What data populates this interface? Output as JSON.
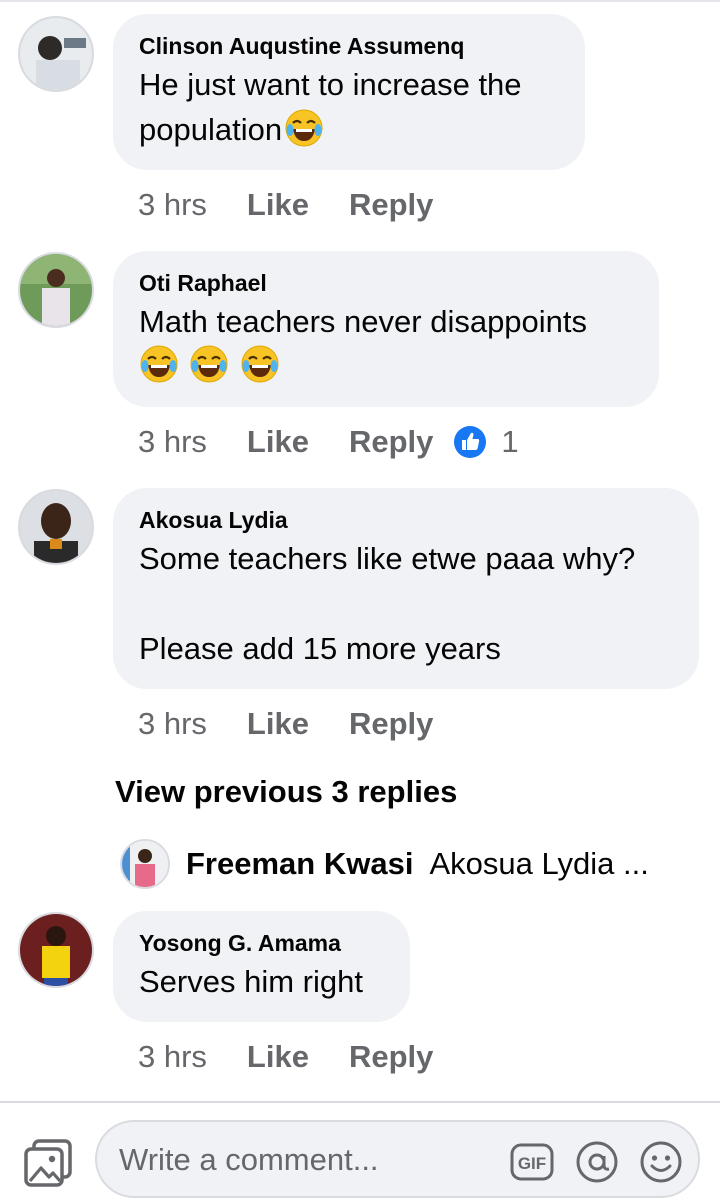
{
  "comments": [
    {
      "author": "Clinson Auqustine Assumenq",
      "text": "He just want to increase the\npopulation",
      "time": "3 hrs",
      "like": "Like",
      "reply": "Reply"
    },
    {
      "author": "Oti Raphael",
      "text": "Math teachers never disappoints",
      "time": "3 hrs",
      "like": "Like",
      "reply": "Reply",
      "reaction_icon": "like-reaction-icon",
      "reaction_count": "1"
    },
    {
      "author": "Akosua Lydia",
      "text": "Some teachers like etwe paaa why?\n\nPlease add 15 more years",
      "time": "3 hrs",
      "like": "Like",
      "reply": "Reply"
    },
    {
      "author": "Yosong G. Amama",
      "text": "Serves him right",
      "time": "3 hrs",
      "like": "Like",
      "reply": "Reply"
    }
  ],
  "view_previous": "View previous 3 replies",
  "reply_preview": {
    "author": "Freeman Kwasi",
    "snippet": "Akosua Lydia ..."
  },
  "composer": {
    "placeholder": "Write a comment...",
    "gif_label": "GIF",
    "icons": [
      "photo-icon",
      "gif-icon",
      "mention-icon",
      "emoji-smile-icon"
    ]
  },
  "colors": {
    "bubble": "#f0f2f5",
    "secondary_text": "#65676b",
    "like_blue": "#1877f2",
    "laugh_yellow": "#f7c325"
  }
}
